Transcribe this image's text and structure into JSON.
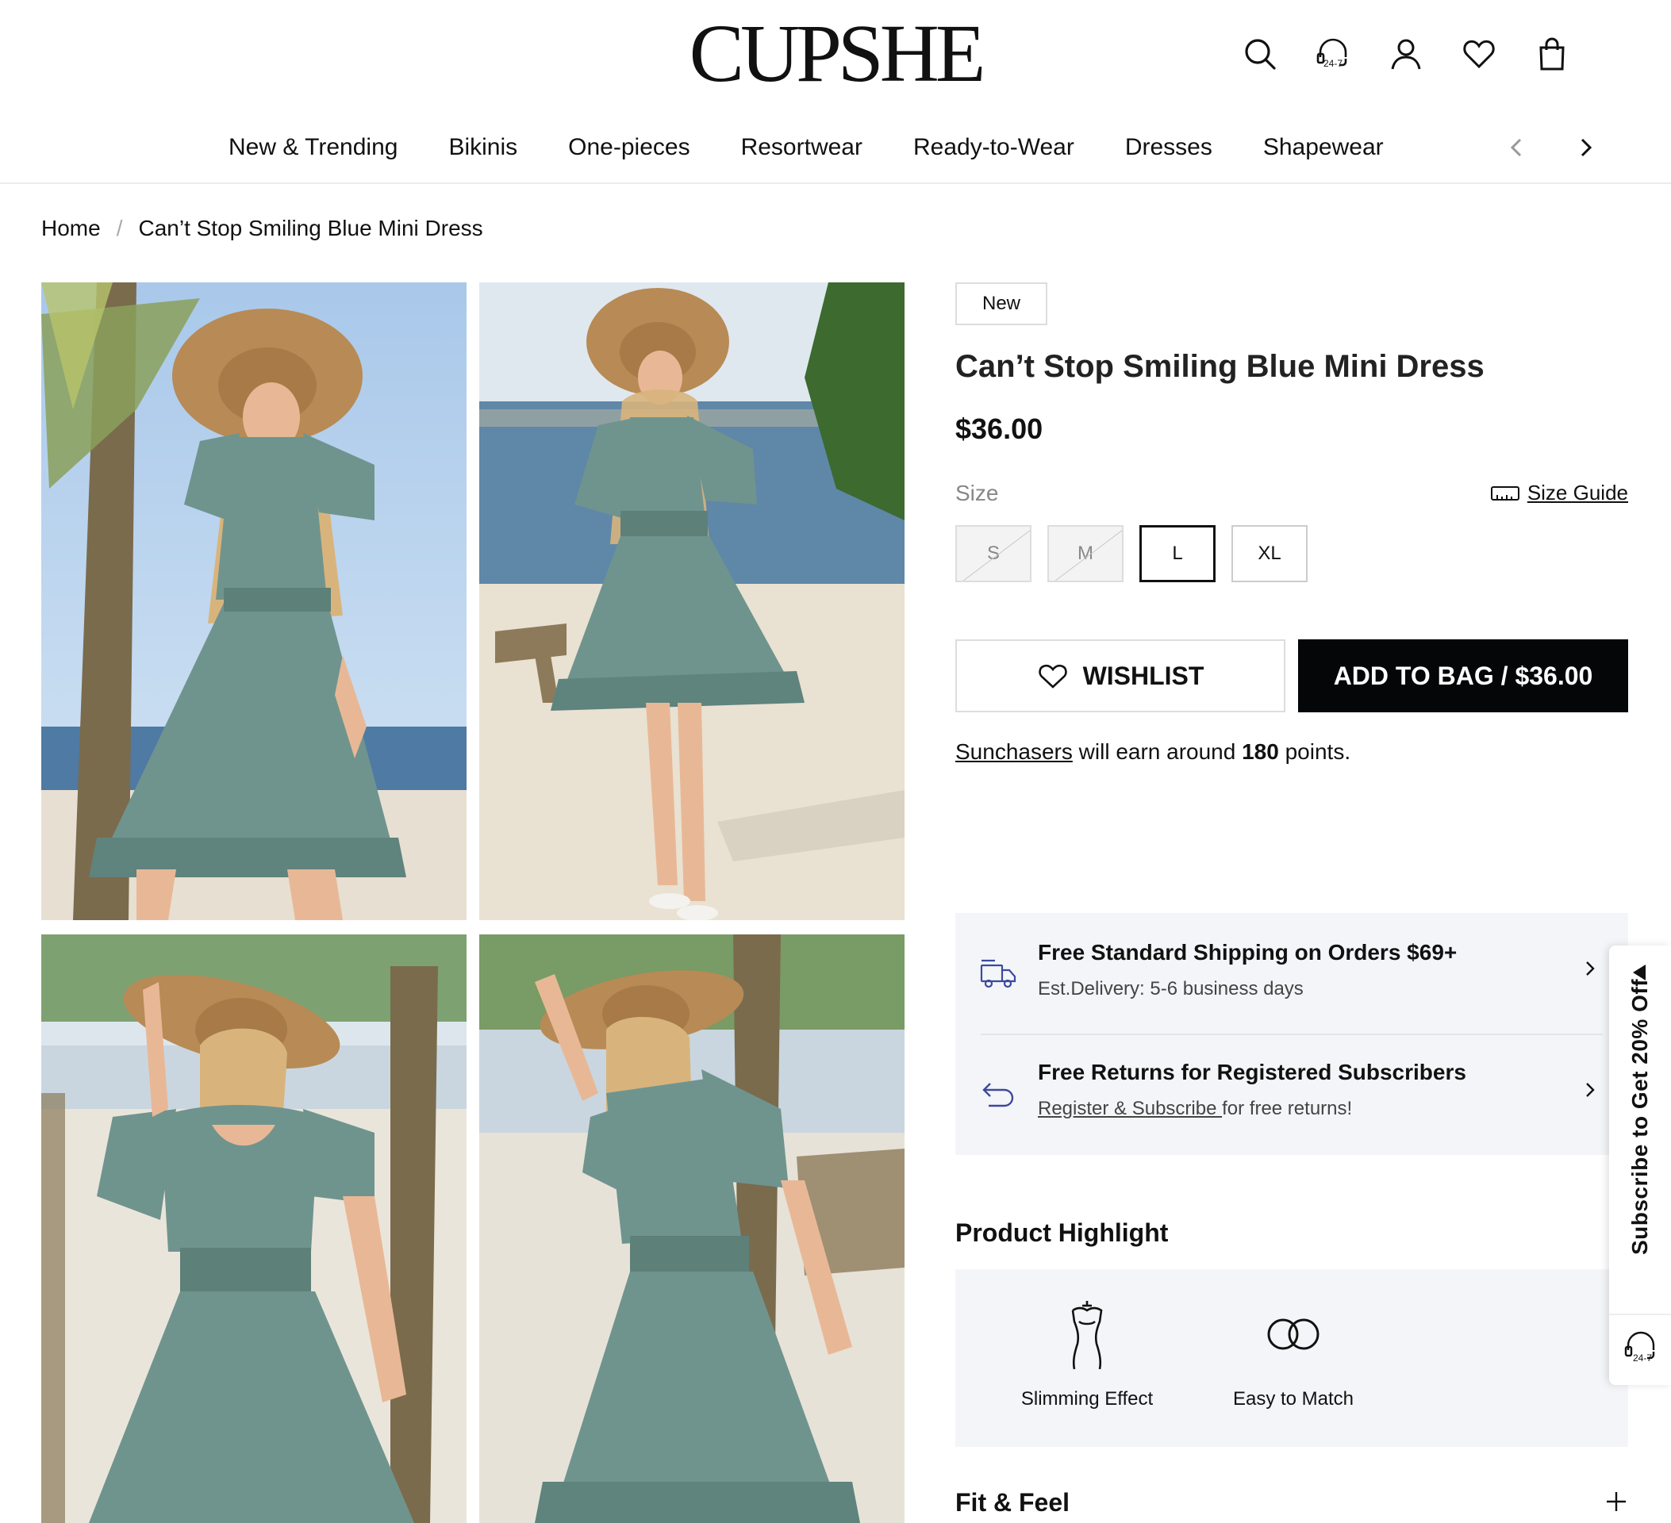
{
  "header": {
    "logo": "CUPSHE",
    "support_badge": "24-7"
  },
  "nav": {
    "items": [
      "New & Trending",
      "Bikinis",
      "One-pieces",
      "Resortwear",
      "Ready-to-Wear",
      "Dresses",
      "Shapewear"
    ]
  },
  "breadcrumb": {
    "home": "Home",
    "separator": "/",
    "current": "Can’t Stop Smiling Blue Mini Dress"
  },
  "product": {
    "badge": "New",
    "title": "Can’t Stop Smiling Blue Mini Dress",
    "price": "$36.00",
    "size_label": "Size",
    "size_guide": "Size Guide",
    "sizes": [
      {
        "label": "S",
        "available": false,
        "selected": false
      },
      {
        "label": "M",
        "available": false,
        "selected": false
      },
      {
        "label": "L",
        "available": true,
        "selected": true
      },
      {
        "label": "XL",
        "available": true,
        "selected": false
      }
    ],
    "wishlist_label": "WISHLIST",
    "add_to_bag_label": "ADD TO BAG / $36.00",
    "points": {
      "link": "Sunchasers",
      "text1": " will earn around ",
      "amount": "180",
      "text2": " points."
    }
  },
  "shipping": {
    "title": "Free Standard Shipping on Orders $69+",
    "subtitle": "Est.Delivery: 5-6 business days"
  },
  "returns": {
    "title": "Free Returns for Registered Subscribers",
    "link": "Register & Subscribe ",
    "text": "for free returns!"
  },
  "highlight": {
    "title": "Product Highlight",
    "items": [
      {
        "label": "Slimming Effect",
        "icon": "dress-form-icon"
      },
      {
        "label": "Easy to Match",
        "icon": "infinity-rings-icon"
      }
    ]
  },
  "fit": {
    "title": "Fit & Feel"
  },
  "side_tab": {
    "text": "Subscribe to Get 20% Off",
    "support_badge": "24-7"
  },
  "colors": {
    "dress": "#6f948e",
    "button_dark": "#050608",
    "panel_bg": "#f4f5f8",
    "icon_blue": "#3b4a9c"
  }
}
